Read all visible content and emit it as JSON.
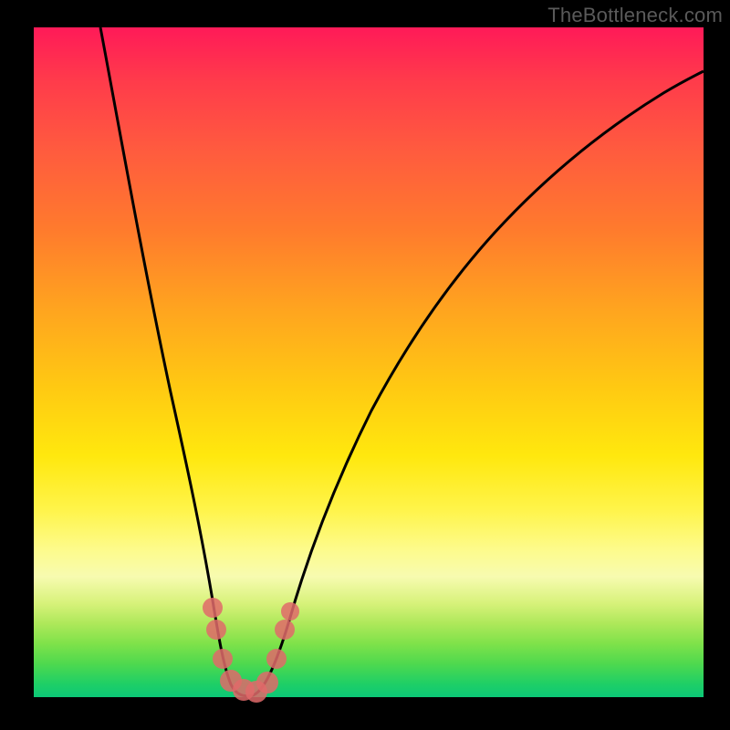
{
  "watermark": "TheBottleneck.com",
  "chart_data": {
    "type": "line",
    "title": "",
    "xlabel": "",
    "ylabel": "",
    "xlim": [
      0,
      100
    ],
    "ylim": [
      0,
      100
    ],
    "grid": false,
    "legend": false,
    "series": [
      {
        "name": "curve",
        "x": [
          10,
          12,
          15,
          18,
          20,
          22,
          24,
          26,
          27,
          28,
          29,
          30,
          32,
          34,
          36,
          40,
          45,
          50,
          55,
          60,
          65,
          70,
          75,
          80,
          85,
          90,
          95,
          100
        ],
        "y": [
          100,
          90,
          78,
          65,
          55,
          46,
          36,
          24,
          16,
          8,
          3,
          0,
          0,
          2,
          6,
          14,
          23,
          31,
          38,
          44,
          49,
          53,
          57,
          60,
          63,
          65,
          67,
          68
        ]
      }
    ],
    "markers": [
      {
        "name": "left-cluster",
        "x": [
          26.5,
          27.2,
          28.0,
          29.5,
          31.0
        ],
        "y": [
          14,
          10,
          5,
          2,
          1
        ]
      },
      {
        "name": "right-cluster",
        "x": [
          33.5,
          35.5,
          36.5
        ],
        "y": [
          2,
          8,
          12
        ]
      }
    ],
    "background_gradient": {
      "top_color": "#ff1a58",
      "bottom_color": "#0cc877"
    }
  }
}
